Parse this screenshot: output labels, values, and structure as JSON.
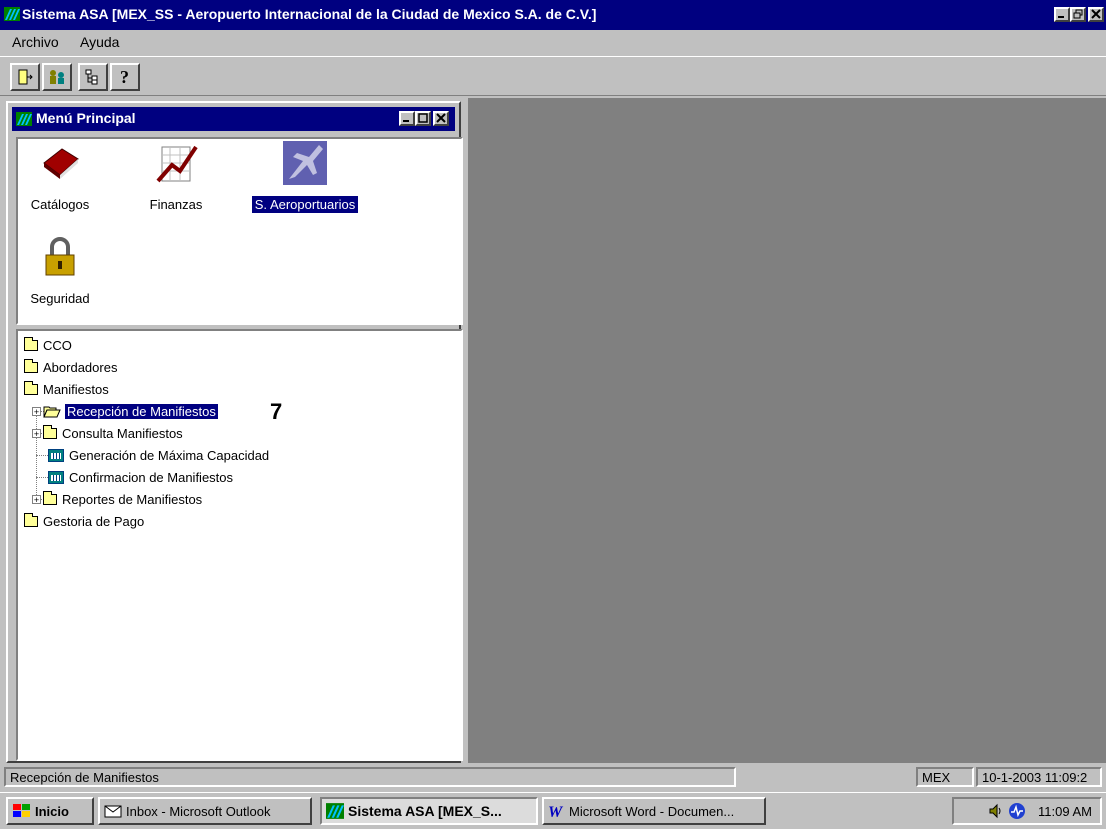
{
  "app": {
    "title": "Sistema ASA [MEX_SS - Aeropuerto Internacional de la Ciudad de Mexico S.A. de C.V.]"
  },
  "menu": {
    "archivo": "Archivo",
    "ayuda": "Ayuda"
  },
  "toolbar": {
    "buttons": [
      "exit-icon",
      "users-icon",
      "tree-icon",
      "help-icon"
    ],
    "help_glyph": "?"
  },
  "child_window": {
    "title": "Menú Principal",
    "icons": [
      {
        "label": "Catálogos",
        "icon": "book-icon"
      },
      {
        "label": "Finanzas",
        "icon": "chart-icon"
      },
      {
        "label": "S. Aeroportuarios",
        "icon": "airplane-icon",
        "selected": true
      },
      {
        "label": "Seguridad",
        "icon": "padlock-icon"
      }
    ]
  },
  "tree": {
    "nodes": [
      {
        "label": "CCO"
      },
      {
        "label": "Abordadores"
      },
      {
        "label": "Manifiestos"
      },
      {
        "label": "Recepción de Manifiestos",
        "selected": true
      },
      {
        "label": "Consulta Manifiestos"
      },
      {
        "label": "Generación de Máxima Capacidad"
      },
      {
        "label": "Confirmacion de Manifiestos"
      },
      {
        "label": "Reportes de Manifiestos"
      },
      {
        "label": "Gestoria de Pago"
      }
    ],
    "expander_glyph": "+",
    "annotation": "7"
  },
  "statusbar": {
    "message": "Recepción de Manifiestos",
    "location": "MEX",
    "datetime": "10-1-2003 11:09:2"
  },
  "taskbar": {
    "start": "Inicio",
    "tasks": [
      {
        "label": "Inbox - Microsoft Outlook"
      },
      {
        "label": "Sistema ASA [MEX_S...",
        "active": true
      },
      {
        "label": "Microsoft Word - Documen..."
      }
    ],
    "clock": "11:09 AM"
  },
  "colors": {
    "titlebar": "#000080",
    "desktop": "#808080",
    "face": "#c0c0c0"
  }
}
